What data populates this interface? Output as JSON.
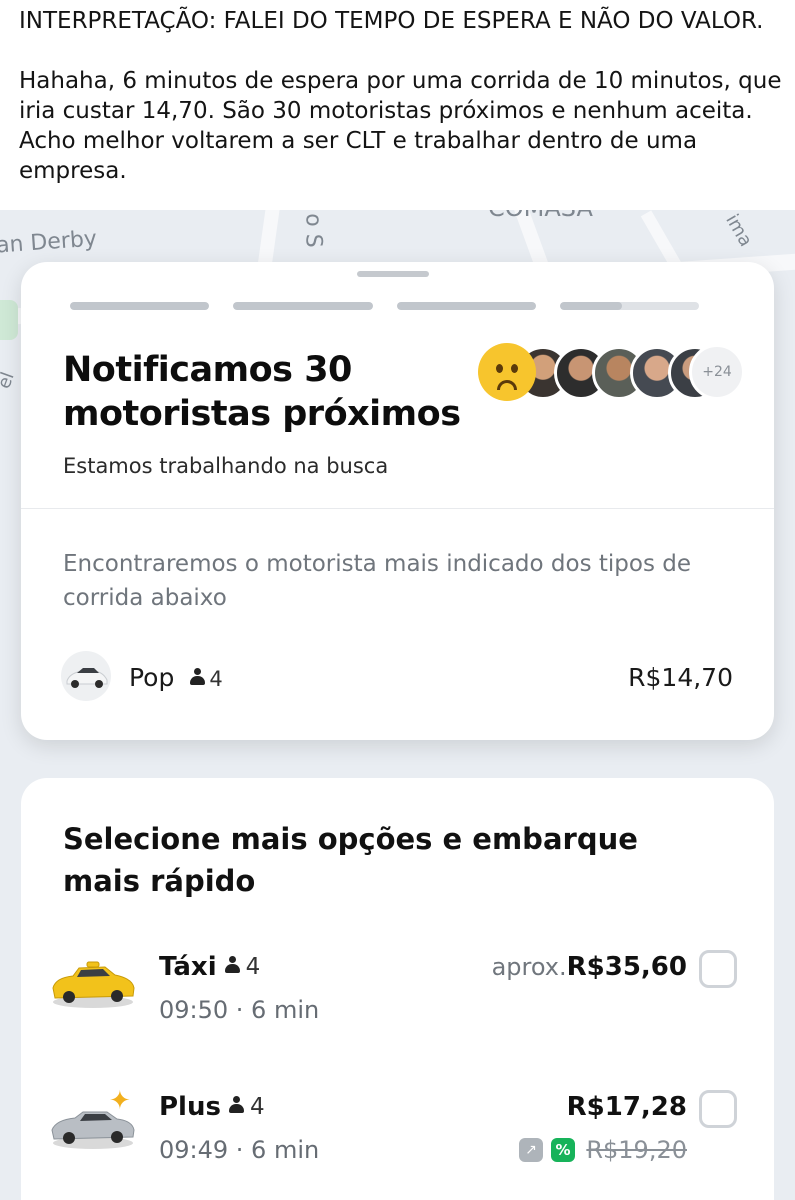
{
  "caption": {
    "line1": "INTERPRETAÇÃO: FALEI DO TEMPO DE ESPERA E NÃO DO VALOR.",
    "line2": "Hahaha, 6 minutos de espera por uma corrida de 10 minutos, que iria custar 14,70. São 30 motoristas próximos e nenhum aceita. Acho melhor voltarem a ser CLT e trabalhar dentro de uma empresa."
  },
  "map": {
    "labels": [
      "an Derby",
      "o S",
      "COMASA",
      "ima",
      "el"
    ]
  },
  "search_card": {
    "title": "Notificamos 30 motoristas próximos",
    "subtitle": "Estamos trabalhando na busca",
    "avatars": [
      "emoji-sad",
      "driver-1",
      "driver-2",
      "driver-3",
      "driver-4",
      "driver-5"
    ],
    "more_drivers": "+24",
    "info_text": "Encontraremos o motorista mais indicado dos tipos de corrida abaixo",
    "progress": [
      1.0,
      1.0,
      1.0,
      0.45
    ],
    "ride": {
      "name": "Pop",
      "seats": "4",
      "price": "R$14,70",
      "icon": "car-white-icon"
    }
  },
  "options_sheet": {
    "title": "Selecione mais opções e embarque mais rápido",
    "options": [
      {
        "name": "Táxi",
        "seats": "4",
        "time": "09:50 · 6 min",
        "approx_label": "aprox.",
        "price": "R$35,60",
        "icon": "taxi-yellow-icon"
      },
      {
        "name": "Plus",
        "seats": "4",
        "time": "09:49 · 6 min",
        "price": "R$17,28",
        "old_price": "R$19,20",
        "icon": "car-silver-icon"
      }
    ]
  },
  "colors": {
    "accent_green": "#17b35a",
    "taxi_yellow": "#f2c21b",
    "map_bg": "#e9edf2"
  }
}
